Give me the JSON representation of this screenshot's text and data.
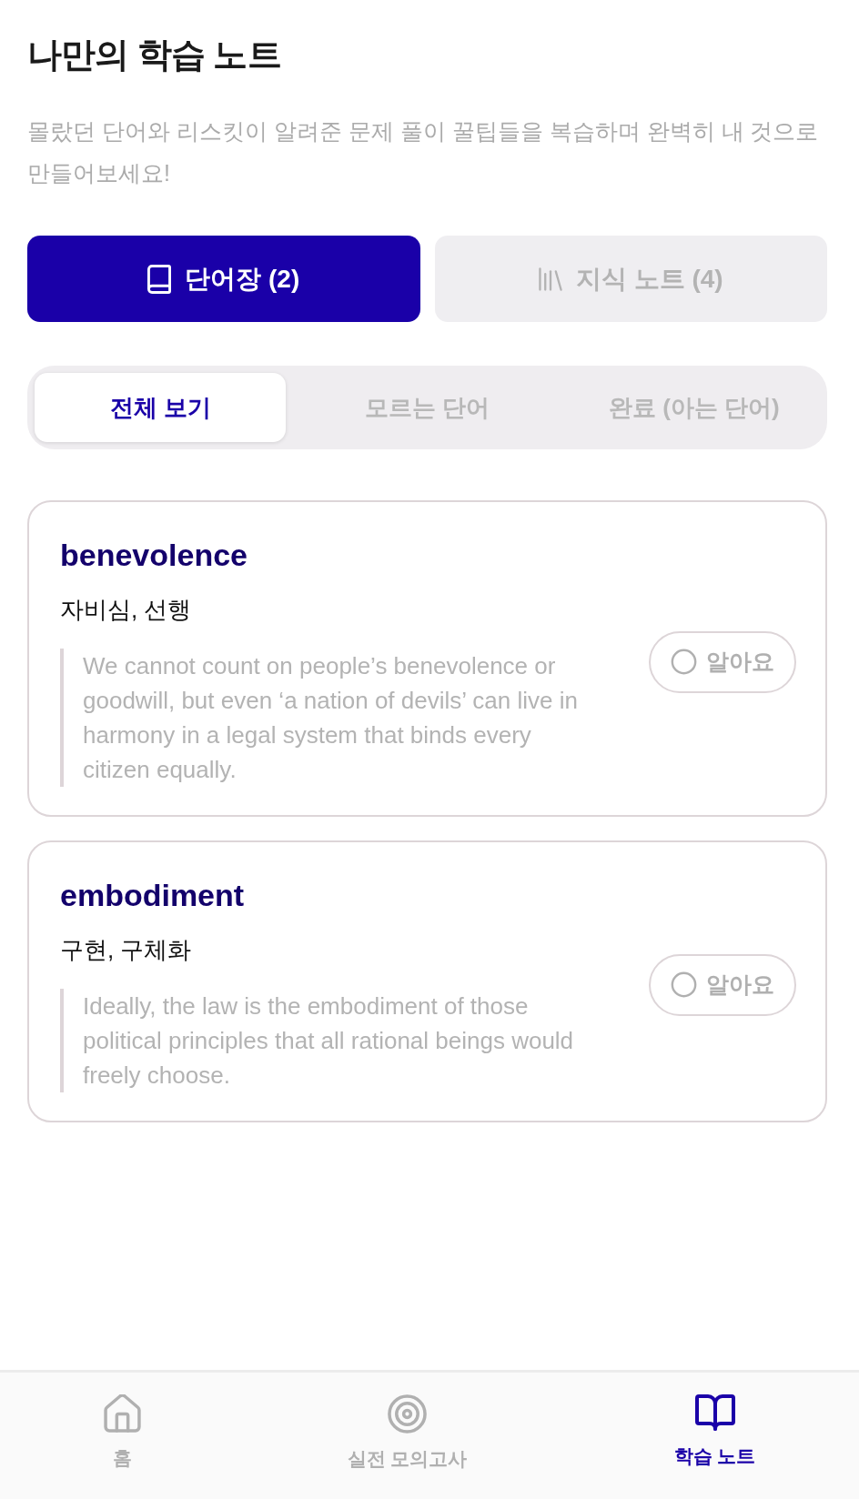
{
  "header": {
    "title": "나만의 학습 노트",
    "description": "몰랐던 단어와 리스킷이 알려준 문제 풀이 꿀팁들을 복습하며 완벽히 내 것으로 만들어보세요!"
  },
  "main_tabs": [
    {
      "label": "단어장 (2)",
      "selected": true
    },
    {
      "label": "지식 노트 (4)",
      "selected": false
    }
  ],
  "filter_tabs": [
    {
      "label": "전체 보기",
      "selected": true
    },
    {
      "label": "모르는 단어",
      "selected": false
    },
    {
      "label": "완료 (아는 단어)",
      "selected": false
    }
  ],
  "words": [
    {
      "word": "benevolence",
      "meaning": "자비심, 선행",
      "example": "We cannot count on people’s benevolence or goodwill, but even ‘a nation of devils’ can live in harmony in a legal system that binds every citizen equally.",
      "button": "알아요",
      "known": false
    },
    {
      "word": "embodiment",
      "meaning": "구현, 구체화",
      "example": "Ideally, the law is the embodiment of those political principles that all rational beings would freely choose.",
      "button": "알아요",
      "known": false
    }
  ],
  "bottom_nav": [
    {
      "label": "홈",
      "selected": false
    },
    {
      "label": "실전 모의고사",
      "selected": false
    },
    {
      "label": "학습 노트",
      "selected": true
    }
  ]
}
